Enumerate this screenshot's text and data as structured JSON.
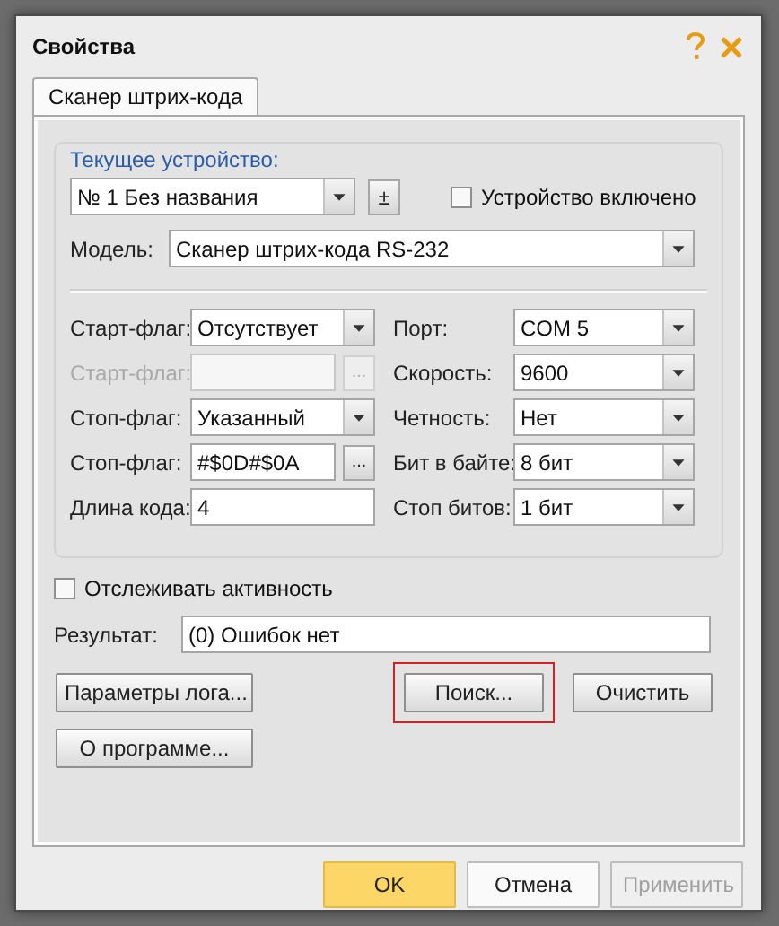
{
  "window": {
    "title": "Свойства"
  },
  "tabs": [
    {
      "label": "Сканер штрих-кода",
      "selected": true
    }
  ],
  "device": {
    "group_label": "Текущее устройство:",
    "current": "№ 1 Без названия",
    "toggle_button": "±",
    "enabled": {
      "label": "Устройство включено",
      "checked": false
    }
  },
  "model": {
    "label": "Модель:",
    "value": "Сканер штрих-кода RS-232"
  },
  "left_fields": [
    {
      "label": "Старт-флаг:",
      "kind": "dropdown",
      "value": "Отсутствует",
      "disabled": false
    },
    {
      "label": "Старт-флаг:",
      "kind": "text_button",
      "button": "...",
      "disabled": true
    },
    {
      "label": "Стоп-флаг:",
      "kind": "dropdown",
      "value": "Указанный",
      "disabled": false
    },
    {
      "label": "Стоп-флаг:",
      "kind": "text_button",
      "value": "#$0D#$0A",
      "button": "...",
      "disabled": false
    },
    {
      "label": "Длина кода:",
      "kind": "text",
      "value": "4",
      "disabled": false
    }
  ],
  "right_fields": [
    {
      "label": "Порт:",
      "value": "COM 5"
    },
    {
      "label": "Скорость:",
      "value": "9600"
    },
    {
      "label": "Четность:",
      "value": "Нет"
    },
    {
      "label": "Бит в байте:",
      "value": "8 бит"
    },
    {
      "label": "Стоп битов:",
      "value": "1 бит"
    }
  ],
  "track_activity": {
    "label": "Отслеживать активность",
    "checked": false
  },
  "result": {
    "label": "Результат:",
    "value": "(0) Ошибок нет"
  },
  "left_buttons": [
    {
      "label": "Параметры лога...",
      "highlighted": false
    },
    {
      "label": "О программе...",
      "highlighted": false
    }
  ],
  "right_buttons": [
    {
      "label": "Поиск...",
      "highlighted": true
    },
    {
      "label": "Очистить",
      "highlighted": false
    }
  ],
  "footer_buttons": [
    {
      "label": "OK",
      "kind": "default",
      "disabled": false
    },
    {
      "label": "Отмена",
      "kind": "normal",
      "disabled": false
    },
    {
      "label": "Применить",
      "kind": "normal",
      "disabled": true
    }
  ]
}
